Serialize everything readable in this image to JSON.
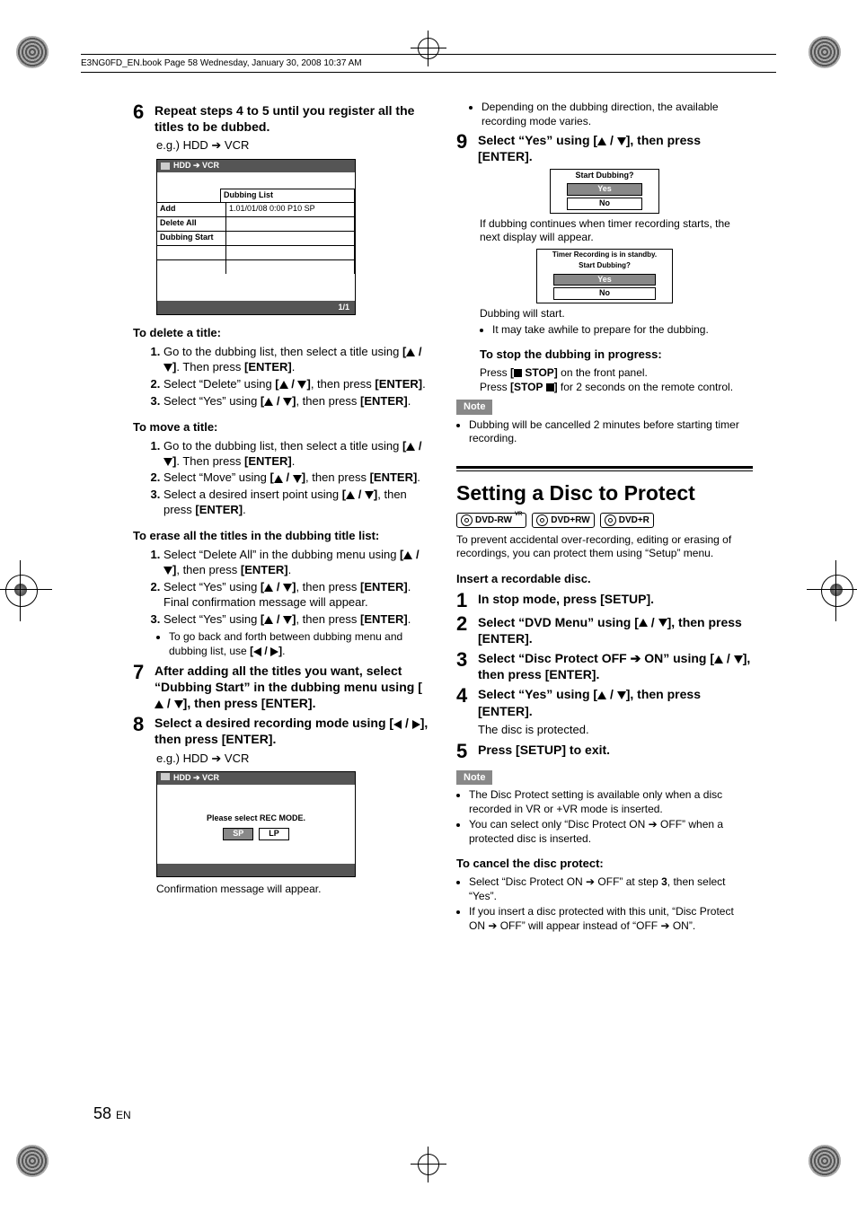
{
  "header": {
    "book": "E3NG0FD_EN.book  Page 58  Wednesday, January 30, 2008  10:37 AM"
  },
  "page": {
    "num": "58",
    "lang": "EN"
  },
  "left": {
    "step6": {
      "title": "Repeat steps 4 to 5 until you register all the titles to be dubbed.",
      "eg": "e.g.) HDD ➔ VCR",
      "uibox": {
        "bar": "HDD  ➔  VCR",
        "col_right": "Dubbing List",
        "rows": [
          "Add",
          "Delete All",
          "Dubbing Start"
        ],
        "data0": "1.01/01/08 0:00 P10 SP",
        "footer": "1/1"
      }
    },
    "delete": {
      "h": "To delete a title:",
      "i1a": "Go to the dubbing list, then select a title using ",
      "i1b": ". Then press ",
      "i1c": "[ENTER]",
      "i1d": ".",
      "i2a": "Select “Delete” using ",
      "i2b": ", then press ",
      "i2c": "[ENTER]",
      "i2d": ".",
      "i3a": "Select “Yes” using ",
      "i3b": ", then press ",
      "i3c": "[ENTER]",
      "i3d": "."
    },
    "move": {
      "h": "To move a title:",
      "i1a": "Go to the dubbing list, then select a title using ",
      "i1b": ". Then press ",
      "i1c": "[ENTER]",
      "i1d": ".",
      "i2a": "Select “Move” using ",
      "i2b": ", then press ",
      "i2c": "[ENTER]",
      "i2d": ".",
      "i3a": "Select a desired insert point using ",
      "i3b": ", then press ",
      "i3c": "[ENTER]",
      "i3d": "."
    },
    "erase": {
      "h": "To erase all the titles in the dubbing title list:",
      "i1a": "Select “Delete All” in the dubbing menu using ",
      "i1b": ", then press ",
      "i1c": "[ENTER]",
      "i1d": ".",
      "i2a": "Select “Yes” using ",
      "i2b": ", then press ",
      "i2c": "[ENTER]",
      "i2d": ". Final confirmation message will appear.",
      "i3a": "Select “Yes” using ",
      "i3b": ", then press ",
      "i3c": "[ENTER]",
      "i3d": ".",
      "tipa": "To go back and forth between dubbing menu and dubbing list, use ",
      "tipb": "."
    },
    "step7": "After adding all the titles you want, select “Dubbing Start” in the dubbing menu using [▲ / ▼], then press [ENTER].",
    "step8": {
      "titlea": "Select a desired recording mode using ",
      "titleb": ", then press [ENTER].",
      "eg": "e.g.) HDD ➔ VCR",
      "uibox": {
        "bar": "HDD  ➔  VCR",
        "prompt": "Please select REC MODE.",
        "sp": "SP",
        "lp": "LP"
      },
      "confirm": "Confirmation message will appear."
    }
  },
  "right": {
    "bullet_top": "Depending on the dubbing direction, the available recording mode varies.",
    "step9": {
      "titlea": "Select “Yes” using ",
      "titleb": ", then press [ENTER].",
      "dialog1": {
        "hdr": "Start Dubbing?",
        "yes": "Yes",
        "no": "No"
      },
      "next": "If dubbing continues when timer recording starts, the next display will appear.",
      "dialog2": {
        "hdr1": "Timer Recording is in standby.",
        "hdr2": "Start Dubbing?",
        "yes": "Yes",
        "no": "No"
      },
      "start": "Dubbing will start.",
      "prep": "It may take awhile to prepare for the dubbing.",
      "stop_h": "To stop the dubbing in progress:",
      "stop1a": "Press ",
      "stop1b": " STOP]",
      "stop1c": " on the front panel.",
      "stop2a": "Press ",
      "stop2b": "[STOP ",
      "stop2c": "]",
      "stop2d": " for 2 seconds on the remote control.",
      "note": "Note",
      "note_b": "Dubbing will be cancelled 2 minutes before starting timer recording."
    },
    "section": "Setting a Disc to Protect",
    "discs": {
      "a": "DVD-RW",
      "avr": "VR",
      "b": "DVD+RW",
      "c": "DVD+R"
    },
    "intro": "To prevent accidental over-recording, editing or erasing of recordings, you can protect them using “Setup” menu.",
    "insert": "Insert a recordable disc.",
    "s1": "In stop mode, press [SETUP].",
    "s2a": "Select “DVD Menu” using ",
    "s2b": ", then press [ENTER].",
    "s3a": "Select “Disc Protect OFF ➔ ON” using ",
    "s3b": ", then press [ENTER].",
    "s4a": "Select “Yes” using ",
    "s4b": ", then press [ENTER].",
    "s4c": "The disc is protected.",
    "s5": "Press [SETUP] to exit.",
    "note2": "Note",
    "nb1": "The Disc Protect setting is available only when a disc recorded in VR or +VR mode is inserted.",
    "nb2": "You can select only “Disc Protect ON ➔ OFF” when a protected disc is inserted.",
    "cancel_h": "To cancel the disc protect:",
    "cb1a": "Select “Disc Protect ON ➔ OFF” at step ",
    "cb1b": "3",
    "cb1c": ", then select “Yes”.",
    "cb2": "If you insert a disc protected with this unit, “Disc Protect ON ➔ OFF” will appear instead of “OFF ➔ ON”."
  }
}
